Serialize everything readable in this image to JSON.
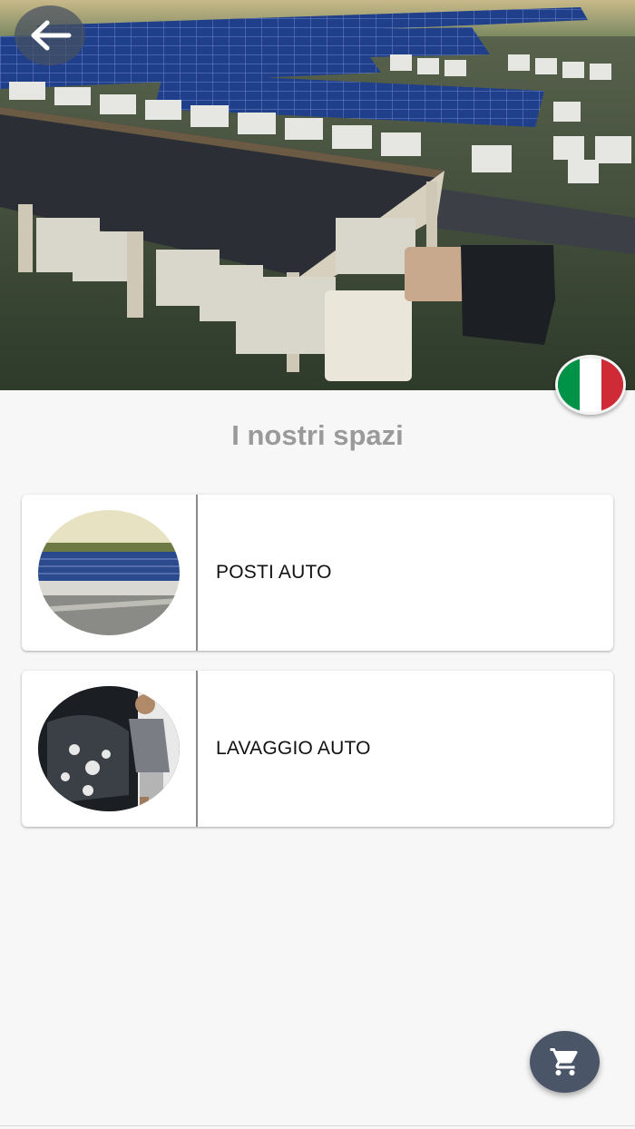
{
  "hero": {
    "image_subject": "aerial view of camper storage with solar carports",
    "back_icon": "arrow-left-icon",
    "language_flag": "italy-flag-icon"
  },
  "section_title": "I nostri spazi",
  "cards": [
    {
      "label": "POSTI AUTO",
      "thumb": "solar-parking-thumbnail"
    },
    {
      "label": "LAVAGGIO AUTO",
      "thumb": "car-wash-thumbnail"
    }
  ],
  "fab": {
    "icon": "cart-icon"
  },
  "colors": {
    "background": "#f7f7f7",
    "title": "#9a9a9a",
    "fab": "#4a5568",
    "flag_green": "#009246",
    "flag_white": "#ffffff",
    "flag_red": "#ce2b37"
  }
}
